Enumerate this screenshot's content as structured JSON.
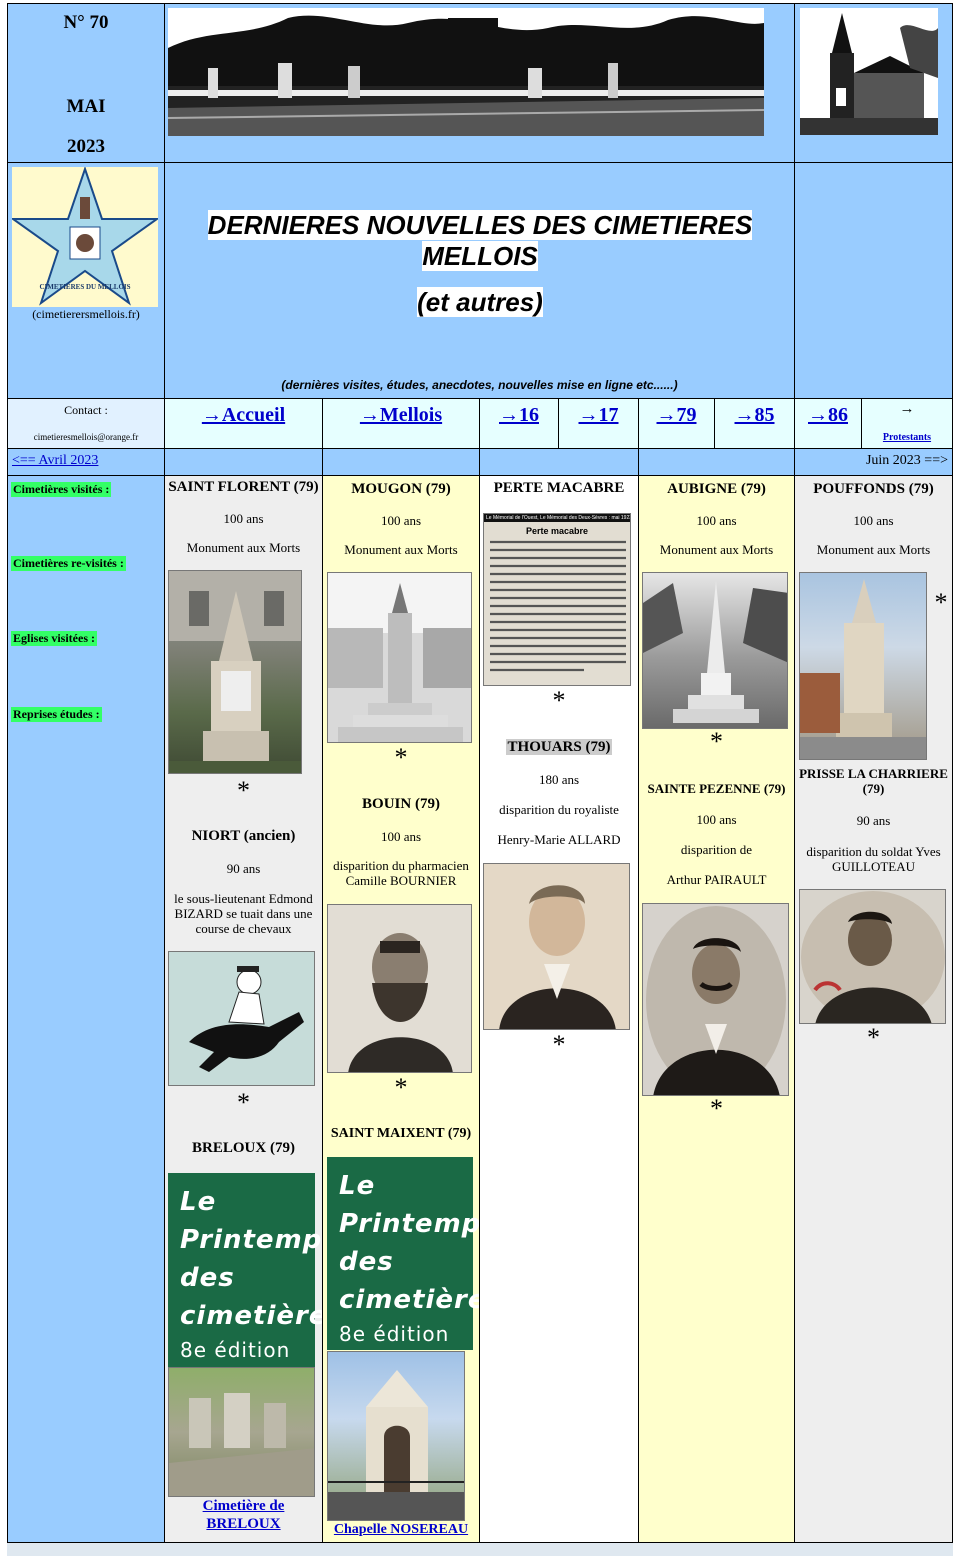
{
  "header": {
    "issue": "N° 70",
    "month": "MAI",
    "year": "2023",
    "logo_caption": "(cimetierersmellois.fr)",
    "logo_text": "CIMETIERES DU MELLOIS",
    "title": "DERNIERES NOUVELLES DES CIMETIERES MELLOIS",
    "subtitle": "(et autres)",
    "tagline": "(dernières visites, études, anecdotes, nouvelles mise en ligne etc......)"
  },
  "contact": {
    "label": "Contact :",
    "email": "cimetieresmellois@orange.fr"
  },
  "nav": {
    "accueil": "→Accueil",
    "mellois": "→Mellois",
    "d16": "→16",
    "d17": "→17",
    "d79": "→79",
    "d85": "→85",
    "d86": "→86",
    "protestants_arrow": "→",
    "protestants": "Protestants"
  },
  "pager": {
    "prev": "<== Avril 2023",
    "next": "Juin 2023 ==>"
  },
  "sidebar": {
    "visited": "Cimetières visités :",
    "revisited": "Cimetières re-visités :",
    "churches": "Eglises visitées :",
    "studies": "Reprises études :"
  },
  "star": "*",
  "col1": {
    "t1": "SAINT FLORENT (79)",
    "a1": "100 ans",
    "d1": "Monument aux Morts",
    "t2": "NIORT (ancien)",
    "a2": "90 ans",
    "d2": "le sous-lieutenant Edmond BIZARD se tuait dans une course de chevaux",
    "t3": "BRELOUX (79)",
    "link": "Cimetière de BRELOUX"
  },
  "col2": {
    "t1": "MOUGON (79)",
    "a1": "100 ans",
    "d1": "Monument aux Morts",
    "t2": "BOUIN (79)",
    "a2": "100 ans",
    "d2": "disparition du pharmacien Camille BOURNIER",
    "t3": "SAINT MAIXENT (79)",
    "link": "Chapelle NOSEREAU"
  },
  "col3": {
    "t1": "PERTE MACABRE",
    "clip_head": "Le Mémorial de l'Ouest, Le Mémorial des Deux-Sèvres : mai 1923",
    "clip_title": "Perte macabre",
    "t2": "THOUARS (79)",
    "a2": "180 ans",
    "d2a": "disparition du royaliste",
    "d2b": "Henry-Marie ALLARD"
  },
  "col4": {
    "t1": "AUBIGNE (79)",
    "a1": "100 ans",
    "d1": "Monument aux Morts",
    "t2": "SAINTE PEZENNE (79)",
    "a2": "100 ans",
    "d2a": "disparition de",
    "d2b": "Arthur PAIRAULT"
  },
  "col5": {
    "t1": "POUFFONDS (79)",
    "a1": "100 ans",
    "d1": "Monument aux Morts",
    "t2": "PRISSE LA CHARRIERE (79)",
    "a2": "90 ans",
    "d2": "disparition du soldat Yves GUILLOTEAU"
  },
  "printemps": {
    "l1": "Le",
    "l2": "Printemps",
    "l3": "des",
    "l4": "cimetières",
    "l5": "8e édition"
  }
}
